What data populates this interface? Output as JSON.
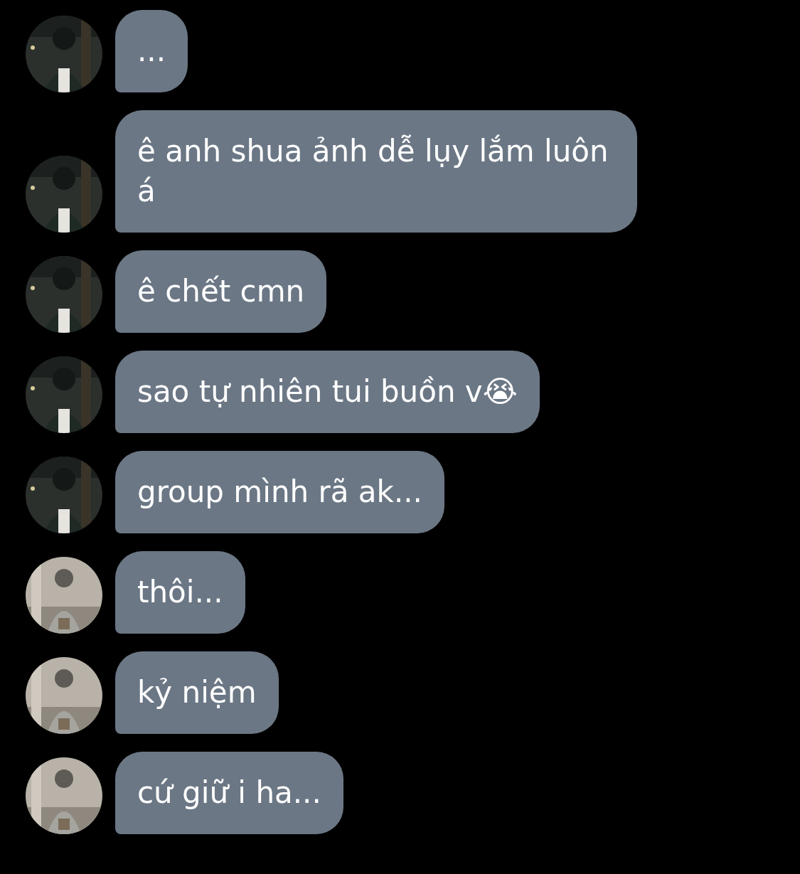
{
  "messages": [
    {
      "text": "..."
    },
    {
      "text": "ê anh shua ảnh dễ lụy lắm luôn á"
    },
    {
      "text": "ê chết cmn"
    },
    {
      "text": "sao tự nhiên tui buồn v😭"
    },
    {
      "text": "group mình rã ak..."
    },
    {
      "text": "thôi..."
    },
    {
      "text": "kỷ niệm"
    },
    {
      "text": "cứ giữ i ha..."
    }
  ]
}
